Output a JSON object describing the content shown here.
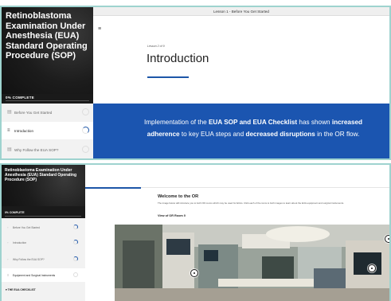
{
  "top": {
    "course_title": "Retinoblastoma Examination Under Anesthesia (EUA) Standard Operating Procedure (SOP)",
    "complete_label": "0% COMPLETE",
    "nav": [
      {
        "label": "Before You Get Started",
        "state": "not-started"
      },
      {
        "label": "Introduction",
        "state": "in-progress"
      },
      {
        "label": "Why Follow the EUA SOP?",
        "state": "not-started"
      }
    ],
    "topbar_title": "Lesson 1 - Before You Get Started",
    "lesson_count": "Lesson 2 of 9",
    "heading": "Introduction",
    "band": {
      "t1": "Implementation of the ",
      "b1": "EUA SOP and EUA Checklist",
      "t2": " has shown ",
      "b2": "increased adherence",
      "t3": " to key EUA steps and ",
      "b3": "decreased disruptions",
      "t4": " in the OR flow."
    },
    "colors": {
      "accent": "#1b55b0",
      "sidebar": "#1a1a1a",
      "frame": "#9ed3cf"
    }
  },
  "bottom": {
    "course_title": "Retinoblastoma Examination Under Anesthesia (EUA) Standard Operating Procedure (SOP)",
    "complete_label": "0% COMPLETE",
    "nav": [
      {
        "label": "Before You Get Started"
      },
      {
        "label": "Introduction"
      },
      {
        "label": "Why Follow the EUA SOP?"
      },
      {
        "label": "Equipment and Surgical Instruments"
      }
    ],
    "section_label": "THE EUA CHECKLIST",
    "welcome_title": "Welcome to the OR",
    "intro_text": "The image below will introduce you to both OR rooms which may be used for EUAs. Click each of the icons to both images to learn about the EUA equipment and surgical instruments.",
    "view_label": "View of OR Room 0",
    "photo_icon": "operating-room-photo"
  }
}
